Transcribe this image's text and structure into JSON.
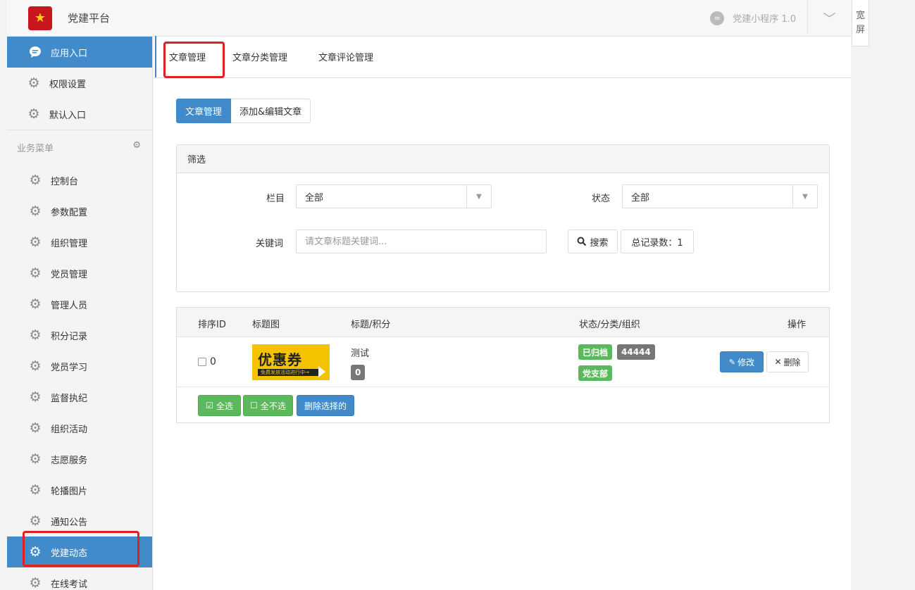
{
  "header": {
    "app_title": "党建平台",
    "mini_program": "党建小程序 1.0",
    "wide_screen": [
      "宽",
      "屏"
    ]
  },
  "sidebar": {
    "top_items": [
      {
        "label": "应用入口",
        "icon": "chat-bubble-icon",
        "active": true
      },
      {
        "label": "权限设置",
        "icon": "gear-icon"
      },
      {
        "label": "默认入口",
        "icon": "gear-icon"
      }
    ],
    "section_title": "业务菜单",
    "biz_items": [
      {
        "label": "控制台"
      },
      {
        "label": "参数配置"
      },
      {
        "label": "组织管理"
      },
      {
        "label": "党员管理"
      },
      {
        "label": "管理人员"
      },
      {
        "label": "积分记录"
      },
      {
        "label": "党员学习"
      },
      {
        "label": "监督执纪"
      },
      {
        "label": "组织活动"
      },
      {
        "label": "志愿服务"
      },
      {
        "label": "轮播图片"
      },
      {
        "label": "通知公告"
      },
      {
        "label": "党建动态",
        "active": true
      },
      {
        "label": "在线考试"
      }
    ]
  },
  "tabs": [
    "文章管理",
    "文章分类管理",
    "文章评论管理"
  ],
  "sub_buttons": [
    "文章管理",
    "添加&编辑文章"
  ],
  "filter": {
    "title": "筛选",
    "column_label": "栏目",
    "column_value": "全部",
    "status_label": "状态",
    "status_value": "全部",
    "keyword_label": "关键词",
    "keyword_placeholder": "请文章标题关键词...",
    "search_button": "搜索",
    "total_records": "总记录数：1"
  },
  "table": {
    "headers": [
      "排序ID",
      "标题图",
      "标题/积分",
      "状态/分类/组织",
      "操作"
    ],
    "rows": [
      {
        "sort_id": "0",
        "thumb_text": "优惠券",
        "thumb_sub": "免费发放活动进行中→",
        "title": "测试",
        "points": "0",
        "status": "已归档",
        "category": "44444",
        "org": "党支部",
        "edit": "修改",
        "delete": "删除"
      }
    ],
    "select_all": "全选",
    "select_none": "全不选",
    "delete_selected": "删除选择的"
  },
  "colors": {
    "primary": "#428bca",
    "success": "#5cb85c",
    "badge_gray": "#777777",
    "highlight": "#e02020"
  }
}
